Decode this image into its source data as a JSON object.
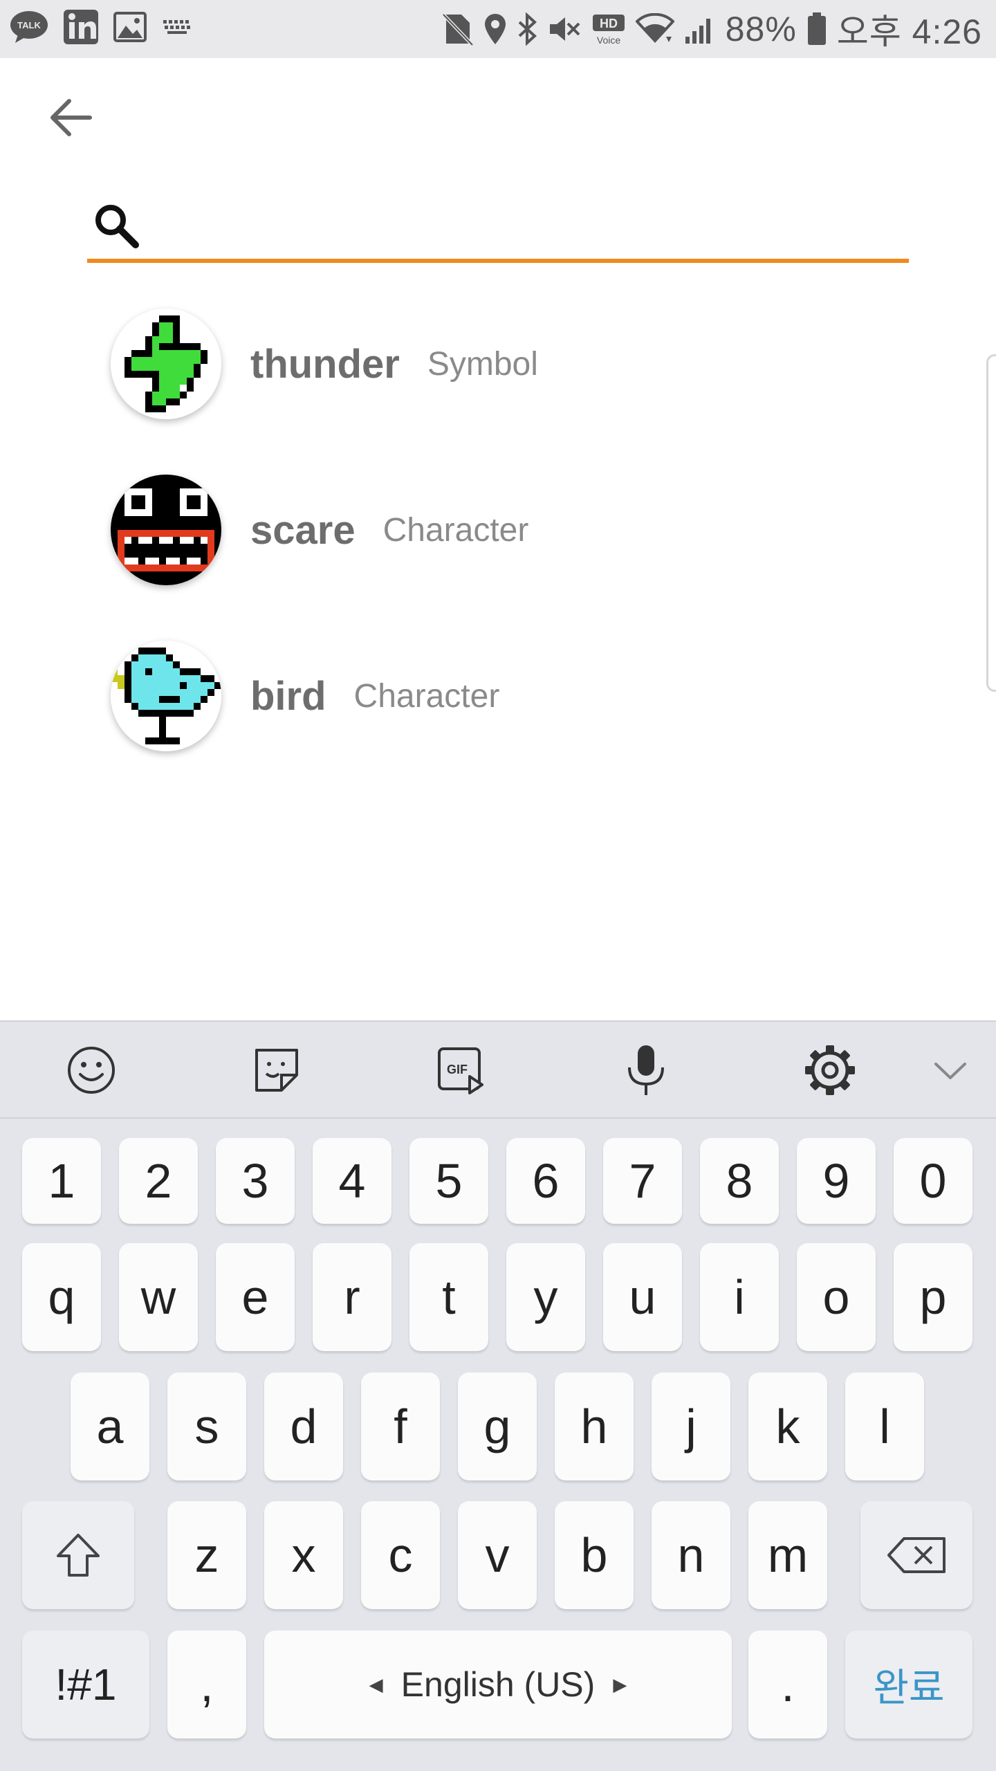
{
  "status_bar": {
    "battery": "88%",
    "time": "오후 4:26",
    "left_icons": [
      "kakaotalk-icon",
      "linkedin-icon",
      "gallery-icon",
      "keyboard-icon"
    ],
    "right_icons": [
      "no-sim-icon",
      "location-icon",
      "bluetooth-icon",
      "mute-icon",
      "hd-voice-icon",
      "wifi-icon",
      "signal-icon",
      "battery-icon"
    ]
  },
  "search": {
    "value": "",
    "placeholder": ""
  },
  "results": [
    {
      "name": "thunder",
      "category": "Symbol"
    },
    {
      "name": "scare",
      "category": "Character"
    },
    {
      "name": "bird",
      "category": "Character"
    }
  ],
  "keyboard": {
    "toolbar": [
      "emoji-icon",
      "sticker-icon",
      "gif-icon",
      "microphone-icon",
      "settings-icon",
      "chevron-down-icon"
    ],
    "row_numbers": [
      "1",
      "2",
      "3",
      "4",
      "5",
      "6",
      "7",
      "8",
      "9",
      "0"
    ],
    "row_top": [
      "q",
      "w",
      "e",
      "r",
      "t",
      "y",
      "u",
      "i",
      "o",
      "p"
    ],
    "row_middle": [
      "a",
      "s",
      "d",
      "f",
      "g",
      "h",
      "j",
      "k",
      "l"
    ],
    "row_bottom": [
      "z",
      "x",
      "c",
      "v",
      "b",
      "n",
      "m"
    ],
    "symbols_label": "!#1",
    "comma_label": ",",
    "space_label": "English (US)",
    "period_label": ".",
    "done_label": "완료"
  },
  "colors": {
    "accent": "#ef8a1b",
    "done": "#3b95c8"
  }
}
